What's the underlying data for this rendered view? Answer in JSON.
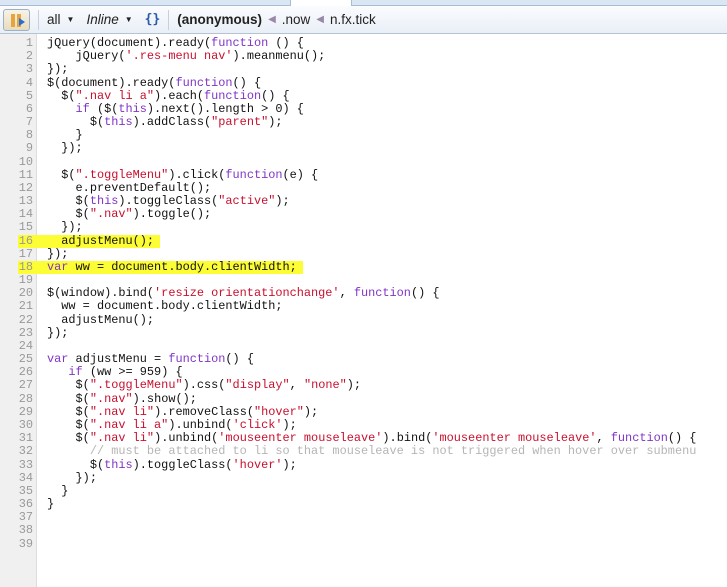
{
  "toolbar": {
    "filter": "all",
    "mode": "Inline",
    "pretty_print_icon": "braces-icon",
    "breadcrumbs": [
      "(anonymous)",
      ".now",
      "n.fx.tick"
    ]
  },
  "highlight_color": "#fdfd35",
  "highlighted_lines": [
    16,
    18
  ],
  "lines": [
    [
      [
        "p",
        "jQuery(document).ready("
      ],
      [
        "kw",
        "function"
      ],
      [
        "p",
        " () {"
      ]
    ],
    [
      [
        "p",
        "    jQuery("
      ],
      [
        "str",
        "'.res-menu nav'"
      ],
      [
        "p",
        ").meanmenu();"
      ]
    ],
    [
      [
        "p",
        "});"
      ]
    ],
    [
      [
        "p",
        "$(document).ready("
      ],
      [
        "kw",
        "function"
      ],
      [
        "p",
        "() {"
      ]
    ],
    [
      [
        "p",
        "  $("
      ],
      [
        "str",
        "\".nav li a\""
      ],
      [
        "p",
        ")."
      ],
      [
        "p",
        "each("
      ],
      [
        "kw",
        "function"
      ],
      [
        "p",
        "() {"
      ]
    ],
    [
      [
        "p",
        "    "
      ],
      [
        "kw",
        "if"
      ],
      [
        "p",
        " ($("
      ],
      [
        "kw",
        "this"
      ],
      [
        "p",
        ").next().length > 0) {"
      ]
    ],
    [
      [
        "p",
        "      $("
      ],
      [
        "kw",
        "this"
      ],
      [
        "p",
        ").addClass("
      ],
      [
        "str",
        "\"parent\""
      ],
      [
        "p",
        ");"
      ]
    ],
    [
      [
        "p",
        "    }"
      ]
    ],
    [
      [
        "p",
        "  });"
      ]
    ],
    [],
    [
      [
        "p",
        "  $("
      ],
      [
        "str",
        "\".toggleMenu\""
      ],
      [
        "p",
        ").click("
      ],
      [
        "kw",
        "function"
      ],
      [
        "p",
        "(e) {"
      ]
    ],
    [
      [
        "p",
        "    e.preventDefault();"
      ]
    ],
    [
      [
        "p",
        "    $("
      ],
      [
        "kw",
        "this"
      ],
      [
        "p",
        ").toggleClass("
      ],
      [
        "str",
        "\"active\""
      ],
      [
        "p",
        ");"
      ]
    ],
    [
      [
        "p",
        "    $("
      ],
      [
        "str",
        "\".nav\""
      ],
      [
        "p",
        ").toggle();"
      ]
    ],
    [
      [
        "p",
        "  });"
      ]
    ],
    [
      [
        "p",
        "  adjustMenu();"
      ]
    ],
    [
      [
        "p",
        "});"
      ]
    ],
    [
      [
        "kw",
        "var"
      ],
      [
        "p",
        " ww = document.body.clientWidth;"
      ]
    ],
    [],
    [
      [
        "p",
        "$(window).bind("
      ],
      [
        "str",
        "'resize orientationchange'"
      ],
      [
        "p",
        ", "
      ],
      [
        "kw",
        "function"
      ],
      [
        "p",
        "() {"
      ]
    ],
    [
      [
        "p",
        "  ww = document.body.clientWidth;"
      ]
    ],
    [
      [
        "p",
        "  adjustMenu();"
      ]
    ],
    [
      [
        "p",
        "});"
      ]
    ],
    [],
    [
      [
        "kw",
        "var"
      ],
      [
        "p",
        " adjustMenu = "
      ],
      [
        "kw",
        "function"
      ],
      [
        "p",
        "() {"
      ]
    ],
    [
      [
        "p",
        "   "
      ],
      [
        "kw",
        "if"
      ],
      [
        "p",
        " (ww >= 959) {"
      ]
    ],
    [
      [
        "p",
        "    $("
      ],
      [
        "str",
        "\".toggleMenu\""
      ],
      [
        "p",
        ").css("
      ],
      [
        "str",
        "\"display\""
      ],
      [
        "p",
        ", "
      ],
      [
        "str",
        "\"none\""
      ],
      [
        "p",
        ");"
      ]
    ],
    [
      [
        "p",
        "    $("
      ],
      [
        "str",
        "\".nav\""
      ],
      [
        "p",
        ").show();"
      ]
    ],
    [
      [
        "p",
        "    $("
      ],
      [
        "str",
        "\".nav li\""
      ],
      [
        "p",
        ").removeClass("
      ],
      [
        "str",
        "\"hover\""
      ],
      [
        "p",
        ");"
      ]
    ],
    [
      [
        "p",
        "    $("
      ],
      [
        "str",
        "\".nav li a\""
      ],
      [
        "p",
        ").unbind("
      ],
      [
        "str",
        "'click'"
      ],
      [
        "p",
        ");"
      ]
    ],
    [
      [
        "p",
        "    $("
      ],
      [
        "str",
        "\".nav li\""
      ],
      [
        "p",
        ").unbind("
      ],
      [
        "str",
        "'mouseenter mouseleave'"
      ],
      [
        "p",
        ").bind("
      ],
      [
        "str",
        "'mouseenter mouseleave'"
      ],
      [
        "p",
        ", "
      ],
      [
        "kw",
        "function"
      ],
      [
        "p",
        "() {"
      ]
    ],
    [
      [
        "p",
        "      "
      ],
      [
        "cm",
        "// must be attached to li so that mouseleave is not triggered when hover over submenu"
      ]
    ],
    [
      [
        "p",
        "      $("
      ],
      [
        "kw",
        "this"
      ],
      [
        "p",
        ").toggleClass("
      ],
      [
        "str",
        "'hover'"
      ],
      [
        "p",
        ");"
      ]
    ],
    [
      [
        "p",
        "    });"
      ]
    ],
    [
      [
        "p",
        "  }"
      ]
    ],
    [
      [
        "p",
        "}"
      ]
    ],
    [],
    [],
    []
  ]
}
